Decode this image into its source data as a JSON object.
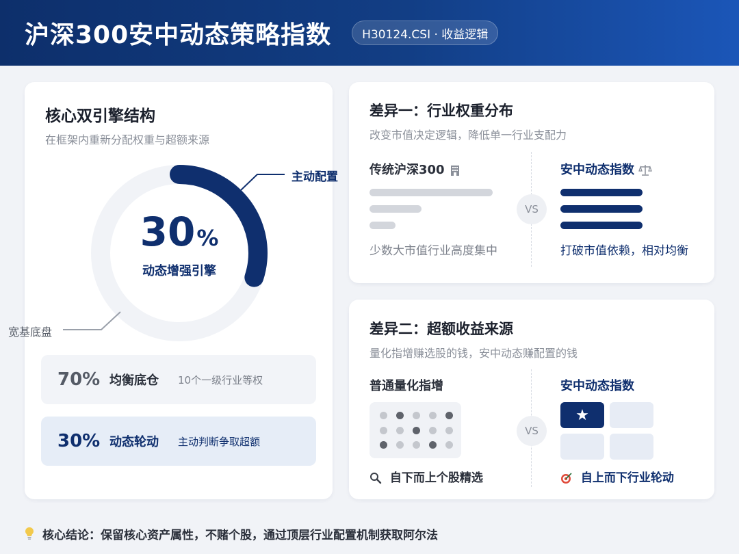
{
  "header": {
    "title": "沪深300安中动态策略指数",
    "tag": "H30124.CSI · 收益逻辑"
  },
  "left": {
    "title": "核心双引擎结构",
    "subtitle": "在框架内重新分配权重与超额来源",
    "ring": {
      "value": "30",
      "unit": "%",
      "label": "动态增强引擎",
      "active_fraction": 0.3,
      "active_label": "主动配置",
      "base_label": "宽基底盘",
      "colors": {
        "active": "#0f2f6e",
        "base": "#f1f3f7"
      }
    },
    "rows": [
      {
        "value": "70%",
        "name": "均衡底仓",
        "desc": "10个一级行业等权"
      },
      {
        "value": "30%",
        "name": "动态轮动",
        "desc": "主动判断争取超额"
      }
    ]
  },
  "diff1": {
    "title": "差异一：行业权重分布",
    "subtitle": "改变市值决定逻辑，降低单一行业支配力",
    "left": {
      "title": "传统沪深300",
      "icon": "building-icon",
      "caption": "少数大市值行业高度集中",
      "bars": [
        1.0,
        0.42,
        0.21
      ]
    },
    "vs": "VS",
    "right": {
      "title": "安中动态指数",
      "icon": "scale-icon",
      "caption": "打破市值依赖，相对均衡",
      "bars": [
        1.0,
        1.0,
        1.0
      ]
    }
  },
  "diff2": {
    "title": "差异二：超额收益来源",
    "subtitle": "量化指增赚选股的钱，安中动态赚配置的钱",
    "left": {
      "title": "普通量化指增",
      "icon": "magnifier-icon",
      "caption": "自下而上个股精选"
    },
    "vs": "VS",
    "right": {
      "title": "安中动态指数",
      "icon": "target-icon",
      "caption": "自上而下行业轮动",
      "star": "★"
    }
  },
  "footer": {
    "icon": "lightbulb-icon",
    "text": "核心结论：保留核心资产属性，不赌个股，通过顶层行业配置机制获取阿尔法"
  }
}
